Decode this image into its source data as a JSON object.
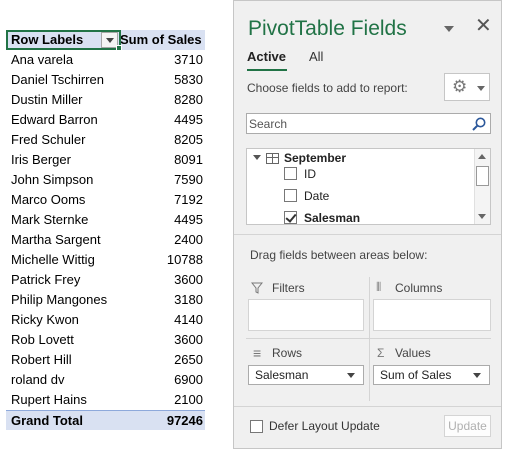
{
  "pivot": {
    "header": {
      "row_labels": "Row Labels",
      "sum_of_sales": "Sum of Sales"
    },
    "rows": [
      {
        "label": "Ana varela",
        "value": "3710"
      },
      {
        "label": "Daniel Tschirren",
        "value": "5830"
      },
      {
        "label": "Dustin Miller",
        "value": "8280"
      },
      {
        "label": "Edward Barron",
        "value": "4495"
      },
      {
        "label": "Fred Schuler",
        "value": "8205"
      },
      {
        "label": "Iris Berger",
        "value": "8091"
      },
      {
        "label": "John Simpson",
        "value": "7590"
      },
      {
        "label": "Marco Ooms",
        "value": "7192"
      },
      {
        "label": "Mark Sternke",
        "value": "4495"
      },
      {
        "label": "Martha Sargent",
        "value": "2400"
      },
      {
        "label": "Michelle Wittig",
        "value": "10788"
      },
      {
        "label": "Patrick Frey",
        "value": "3600"
      },
      {
        "label": "Philip Mangones",
        "value": "3180"
      },
      {
        "label": "Ricky Kwon",
        "value": "4140"
      },
      {
        "label": "Rob Lovett",
        "value": "3600"
      },
      {
        "label": "Robert Hill",
        "value": "2650"
      },
      {
        "label": "roland dv",
        "value": "6900"
      },
      {
        "label": "Rupert Hains",
        "value": "2100"
      }
    ],
    "grand_total": {
      "label": "Grand Total",
      "value": "97246"
    }
  },
  "pane": {
    "title": "PivotTable Fields",
    "close_glyph": "✕",
    "tabs": [
      {
        "label": "Active"
      },
      {
        "label": "All"
      }
    ],
    "choose_text": "Choose fields to add to report:",
    "gear_glyph": "⚙",
    "search": {
      "placeholder": "Search"
    },
    "fields": {
      "table_name": "September",
      "items": [
        {
          "label": "ID",
          "checked": false
        },
        {
          "label": "Date",
          "checked": false
        },
        {
          "label": "Salesman",
          "checked": true
        }
      ]
    },
    "drag_text": "Drag fields between areas below:",
    "areas": {
      "filters": {
        "title": "Filters",
        "icon": "filter-icon"
      },
      "columns": {
        "title": "Columns",
        "icon": "columns-icon",
        "glyph": "⦀"
      },
      "rows": {
        "title": "Rows",
        "icon": "rows-icon",
        "glyph": "≡",
        "field": "Salesman"
      },
      "values": {
        "title": "Values",
        "icon": "sigma-icon",
        "glyph": "Σ",
        "field": "Sum of Sales"
      }
    },
    "defer_label": "Defer Layout Update",
    "update_label": "Update"
  },
  "colors": {
    "accent": "#217346",
    "pivot_header_bg": "#d9e1f2",
    "pane_bg": "#f0f0f0"
  }
}
